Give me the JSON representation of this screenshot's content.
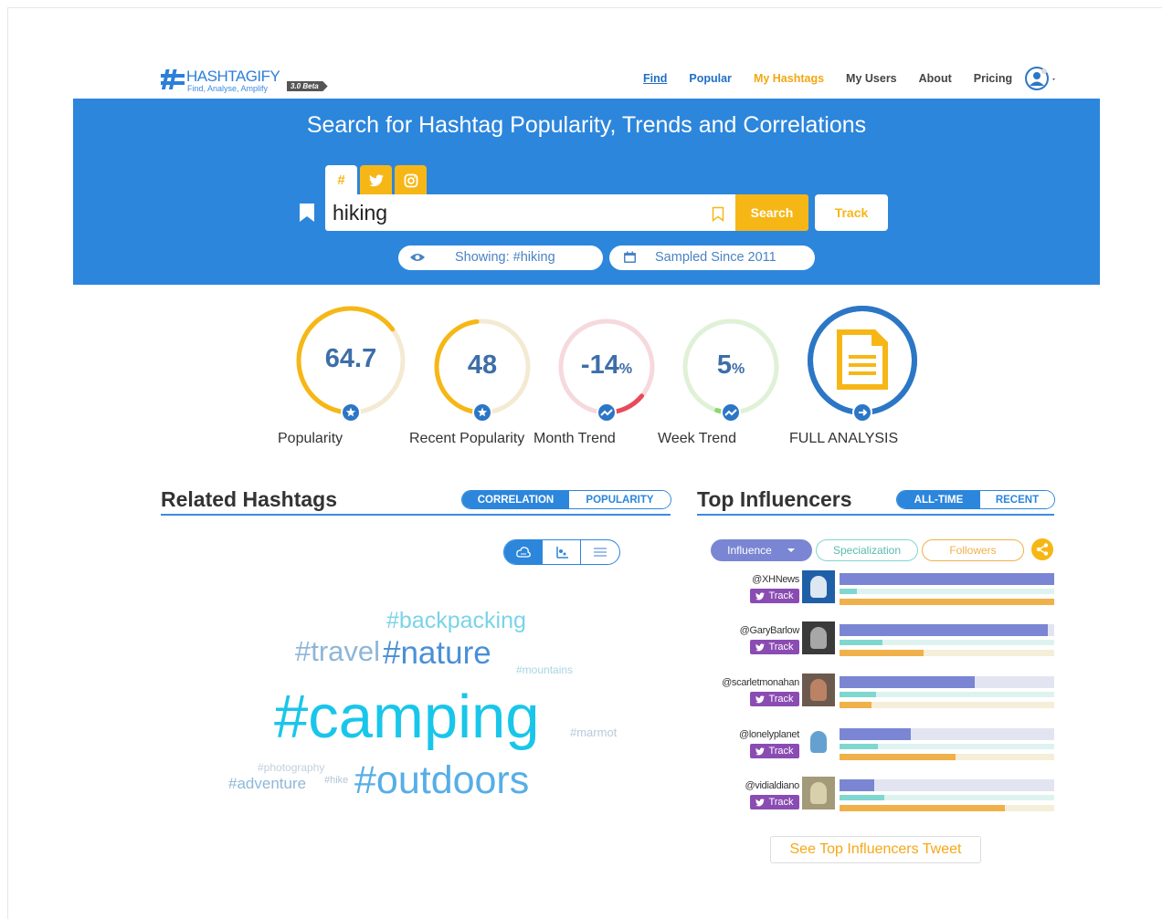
{
  "header": {
    "logo_title": "HASHTAGIFY",
    "logo_tagline": "Find, Analyse, Amplify",
    "logo_badge": "3.0 Beta",
    "nav": [
      "Find",
      "Popular",
      "My Hashtags",
      "My Users",
      "About",
      "Pricing"
    ],
    "user_icon": "user-circle-icon"
  },
  "hero": {
    "title": "Search for Hashtag Popularity, Trends and Correlations",
    "tabs": [
      "#",
      "twitter-icon",
      "instagram-icon"
    ],
    "search_value": "hiking",
    "search_button": "Search",
    "track_button": "Track",
    "showing": "Showing: #hiking",
    "sampled": "Sampled Since 2011"
  },
  "gauges": [
    {
      "value": "64.7",
      "unit": "",
      "label": "Popularity",
      "level": 0.647,
      "color": "#f6b716",
      "icon": "star-icon"
    },
    {
      "value": "48",
      "unit": "",
      "label": "Recent Popularity",
      "level": 0.48,
      "color": "#f6b716",
      "icon": "star-icon"
    },
    {
      "value": "-14",
      "unit": "%",
      "label": "Month Trend",
      "level": 0.14,
      "color": "#e94a5a",
      "icon": "trend-icon"
    },
    {
      "value": "5",
      "unit": "%",
      "label": "Week Trend",
      "level": 0.05,
      "color": "#8fd66e",
      "icon": "trend-icon"
    },
    {
      "value": "",
      "unit": "",
      "label": "FULL ANALYSIS",
      "level": 1.0,
      "color": "#2c76c6",
      "icon": "document-icon"
    }
  ],
  "related": {
    "title": "Related Hashtags",
    "toggle_on": "CORRELATION",
    "toggle_off": "POPULARITY",
    "words": [
      {
        "text": "#backpacking",
        "color": "#7ad3e8"
      },
      {
        "text": "#travel",
        "color": "#8eb6d8"
      },
      {
        "text": "#nature",
        "color": "#4a8fd6"
      },
      {
        "text": "#mountains",
        "color": "#a9d5e0"
      },
      {
        "text": "#camping",
        "color": "#19c6ea"
      },
      {
        "text": "#marmot",
        "color": "#b9c8da"
      },
      {
        "text": "#photography",
        "color": "#c3cfdc"
      },
      {
        "text": "#adventure",
        "color": "#8fb8d8"
      },
      {
        "text": "#hike",
        "color": "#b4c4d4"
      },
      {
        "text": "#outdoors",
        "color": "#56aee6"
      }
    ]
  },
  "influencers": {
    "title": "Top Influencers",
    "toggle_on": "ALL-TIME",
    "toggle_off": "RECENT",
    "filters": [
      "Influence",
      "Specialization",
      "Followers"
    ],
    "track_label": "Track",
    "list": [
      {
        "handle": "@XHNews",
        "influence": 1.0,
        "specialization": 0.08,
        "followers": 1.0
      },
      {
        "handle": "@GaryBarlow",
        "influence": 0.97,
        "specialization": 0.2,
        "followers": 0.39
      },
      {
        "handle": "@scarletmonahan",
        "influence": 0.63,
        "specialization": 0.17,
        "followers": 0.15
      },
      {
        "handle": "@lonelyplanet",
        "influence": 0.33,
        "specialization": 0.18,
        "followers": 0.54
      },
      {
        "handle": "@vidialdiano",
        "influence": 0.16,
        "specialization": 0.21,
        "followers": 0.77
      }
    ],
    "see_button": "See Top Influencers Tweet"
  },
  "colors": {
    "brand": "#2c86dc",
    "accent": "#f6b716",
    "influence": "#7a86d3",
    "specialization": "#7fd7cf",
    "followers": "#f0b04a"
  }
}
